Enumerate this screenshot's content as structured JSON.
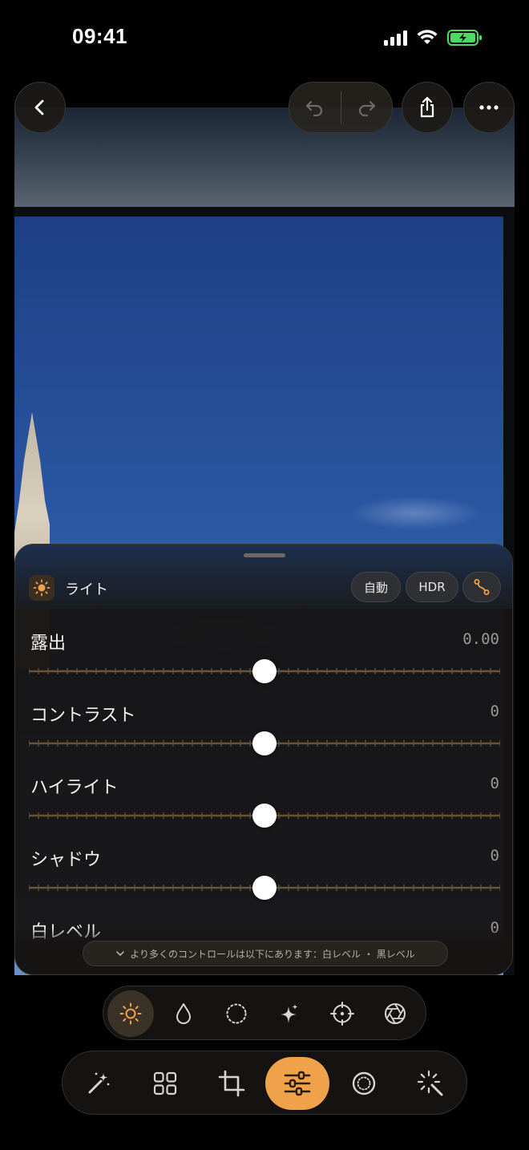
{
  "status_bar": {
    "time": "09:41"
  },
  "panel": {
    "section_title": "ライト",
    "auto_label": "自動",
    "hdr_label": "HDR",
    "sliders": [
      {
        "label": "露出",
        "value": "0.00",
        "position": 0.5
      },
      {
        "label": "コントラスト",
        "value": "0",
        "position": 0.5
      },
      {
        "label": "ハイライト",
        "value": "0",
        "position": 0.5
      },
      {
        "label": "シャドウ",
        "value": "0",
        "position": 0.5
      },
      {
        "label": "白レベル",
        "value": "0",
        "position": 0.5
      }
    ],
    "more_controls_text": "より多くのコントロールは以下にあります：白レベル ・ 黒レベル"
  },
  "categories": [
    "light-icon",
    "color-icon",
    "vignette-icon",
    "effects-icon",
    "detail-icon",
    "lens-icon"
  ],
  "tools": [
    "auto-enhance-icon",
    "presets-icon",
    "crop-icon",
    "adjust-icon",
    "selective-icon",
    "magic-icon"
  ],
  "colors": {
    "accent": "#f0a24a",
    "panel": "#161513",
    "battery": "#4cd964"
  }
}
